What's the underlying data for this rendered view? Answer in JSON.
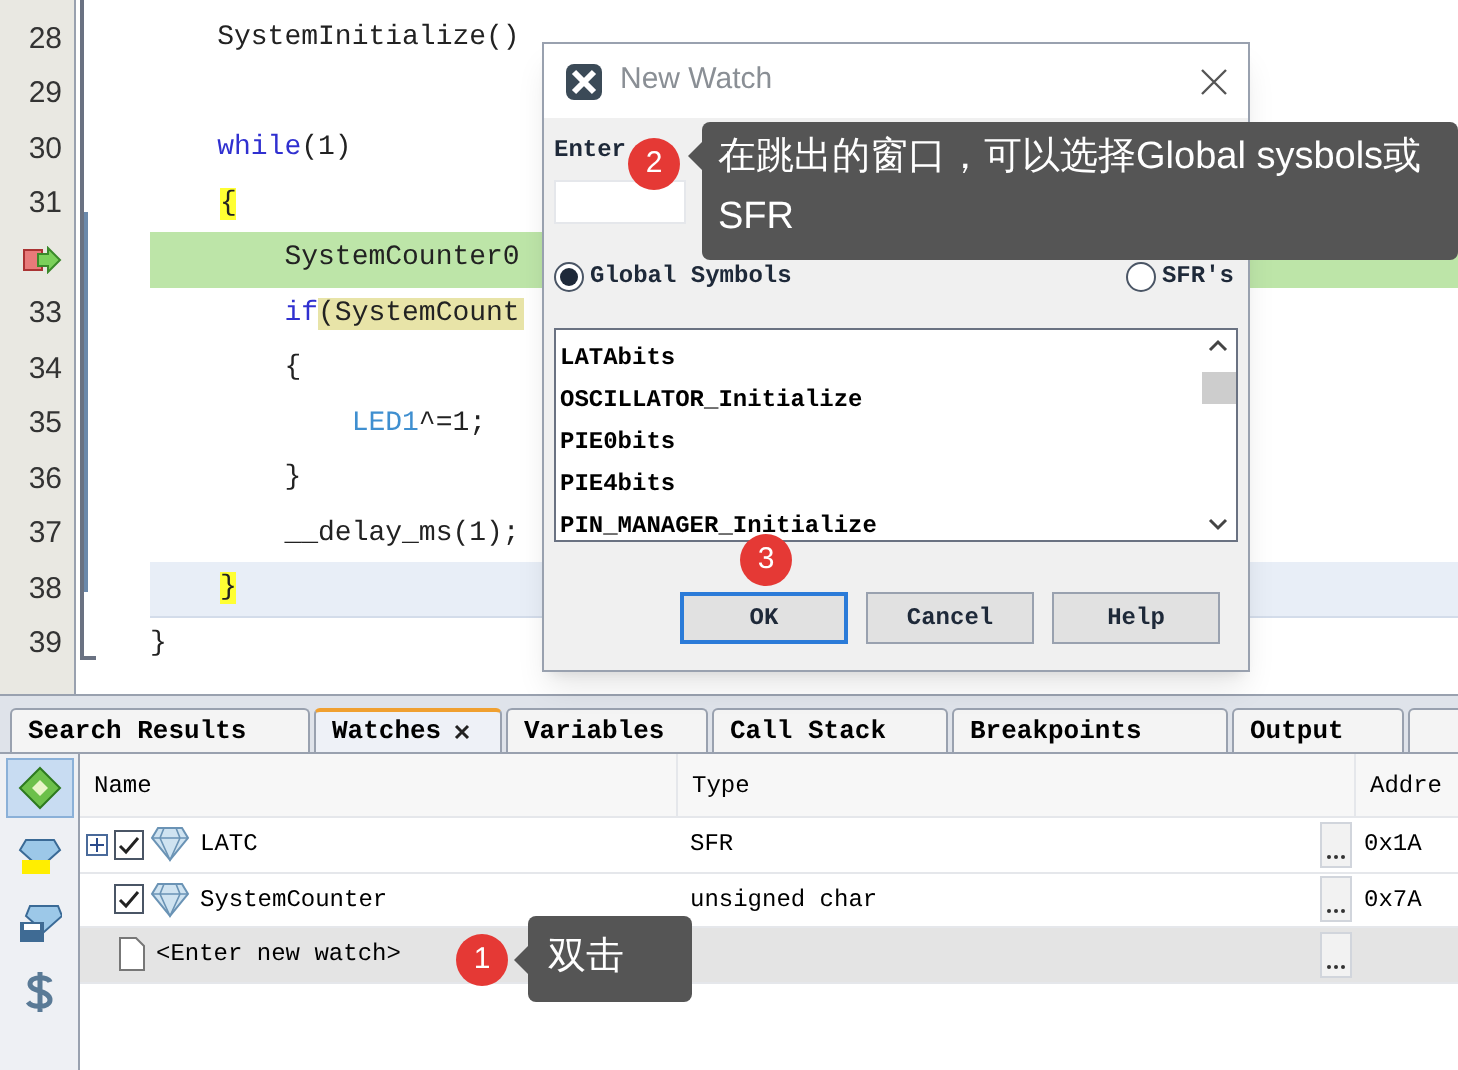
{
  "editor": {
    "lines": [
      {
        "number": "28",
        "current": false,
        "caret": false,
        "segments": [
          {
            "text": "    SystemInitialize()",
            "kind": "plain"
          }
        ]
      },
      {
        "number": "29",
        "current": false,
        "caret": false
      },
      {
        "number": "30",
        "current": false,
        "caret": false,
        "segments": [
          {
            "text": "    while",
            "kind": "keyword"
          },
          {
            "text": "(1)",
            "kind": "plain"
          }
        ]
      },
      {
        "number": "31",
        "current": false,
        "caret": false,
        "segments": [
          {
            "text": "{",
            "kind": "match"
          }
        ]
      },
      {
        "current": true,
        "caret": false,
        "segments": [
          {
            "text": "        SystemCounter0",
            "kind": "plain"
          }
        ]
      },
      {
        "number": "33",
        "current": false,
        "caret": false,
        "segments": [
          {
            "text": "        if",
            "kind": "keyword"
          },
          {
            "text": "(SystemCount",
            "kind": "mark"
          }
        ]
      },
      {
        "number": "34",
        "current": false,
        "caret": false,
        "segments": [
          {
            "text": "        {",
            "kind": "plain"
          }
        ]
      },
      {
        "number": "35",
        "current": false,
        "caret": false,
        "segments": [
          {
            "text": "            LED1",
            "kind": "field"
          },
          {
            "text": "^=1;",
            "kind": "plain"
          }
        ]
      },
      {
        "number": "36",
        "current": false,
        "caret": false,
        "segments": [
          {
            "text": "        }",
            "kind": "plain"
          }
        ]
      },
      {
        "number": "37",
        "current": false,
        "caret": false,
        "segments": [
          {
            "text": "        __delay_ms(1);",
            "kind": "plain"
          }
        ]
      },
      {
        "number": "38",
        "current": false,
        "caret": true,
        "segments": [
          {
            "text": "}",
            "kind": "match"
          }
        ]
      },
      {
        "number": "39",
        "current": false,
        "caret": false,
        "segments": [
          {
            "text": "}",
            "kind": "plain"
          }
        ]
      }
    ]
  },
  "dialog": {
    "title": "New Watch",
    "label": "Enter",
    "radios": [
      {
        "label": "Global Symbols",
        "selected": true
      },
      {
        "label": "SFR's",
        "selected": false
      }
    ],
    "list": [
      "LATAbits",
      "OSCILLATOR_Initialize",
      "PIE0bits",
      "PIE4bits",
      "PIN_MANAGER_Initialize"
    ],
    "buttons": [
      {
        "label": "OK",
        "focused": true
      },
      {
        "label": "Cancel",
        "focused": false
      },
      {
        "label": "Help",
        "focused": false
      }
    ]
  },
  "panel": {
    "tabs": [
      {
        "label": "Search Results",
        "selected": false,
        "closable": false
      },
      {
        "label": "Watches",
        "selected": true,
        "closable": true
      },
      {
        "label": "Variables",
        "selected": false,
        "closable": false
      },
      {
        "label": "Call Stack",
        "selected": false,
        "closable": false
      },
      {
        "label": "Breakpoints",
        "selected": false,
        "closable": false
      },
      {
        "label": "Output",
        "selected": false,
        "closable": false
      },
      {
        "selected": false,
        "closable": false
      }
    ],
    "tools": [
      {
        "kind": "watch",
        "selected": true
      },
      {
        "kind": "folder",
        "selected": false
      },
      {
        "kind": "disk",
        "selected": false
      },
      {
        "kind": "dollar",
        "selected": false
      }
    ],
    "columns": [
      "Name",
      "Type",
      "Addre"
    ],
    "rows": [
      {
        "kind": "watch",
        "expandable": true,
        "checked": true,
        "name": "LATC",
        "type": "SFR",
        "address": "0x1A",
        "selected": false
      },
      {
        "kind": "watch",
        "expandable": false,
        "checked": true,
        "name": "SystemCounter",
        "type": "unsigned char",
        "address": "0x7A",
        "selected": false
      },
      {
        "kind": "new",
        "name": "<Enter new watch>",
        "selected": true
      }
    ]
  },
  "callouts": [
    {
      "number": "1",
      "text": "双击"
    },
    {
      "number": "2",
      "text": "在跳出的窗口，可以选择Global sysbols或SFR"
    },
    {
      "number": "3"
    }
  ]
}
